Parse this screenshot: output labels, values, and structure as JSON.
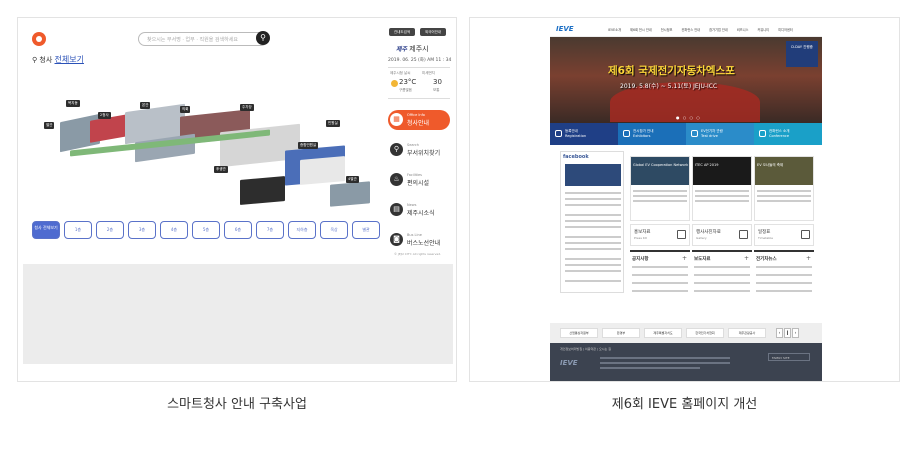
{
  "captions": {
    "left": "스마트청사 안내 구축사업",
    "right": "제6회 IEVE 홈페이지 개선"
  },
  "kiosk": {
    "search_placeholder": "찾으시는 부서명 · 업무 · 직원을 검색하세요",
    "location_label": "청사",
    "location_link": "전체보기",
    "top_buttons": [
      "관내도검색",
      "외국어안내"
    ],
    "brand_logo": "제주",
    "brand_name": "제주시",
    "date": "2019. 06. 25 (화)",
    "time": "AM 11 : 34",
    "weather": {
      "left_label": "제주시청 날씨",
      "temp": "23°C",
      "temp_sub": "구름많음",
      "right_label": "미세먼지",
      "dust": "30",
      "dust_sub": "보통"
    },
    "menu": [
      {
        "en": "Office Info",
        "ko": "청사안내",
        "icon": "building-icon"
      },
      {
        "en": "Search",
        "ko": "부서위치찾기",
        "icon": "search-icon"
      },
      {
        "en": "Facilities",
        "ko": "편의시설",
        "icon": "facility-icon"
      },
      {
        "en": "News",
        "ko": "제주시소식",
        "icon": "news-icon"
      },
      {
        "en": "Bus Line",
        "ko": "버스노선안내",
        "icon": "bus-icon"
      }
    ],
    "copyright": "© JEJU CITY. All rights reserved.",
    "map_labels": [
      "복지동",
      "별관",
      "2청사",
      "본관",
      "의회",
      "주차장",
      "민원실",
      "종합민원실",
      "후생관",
      "4별관"
    ],
    "floors": [
      "청사 전체보기",
      "1층",
      "2층",
      "3층",
      "4층",
      "5층",
      "6층",
      "7층",
      "지하층",
      "옥상",
      "별관",
      "후생관"
    ]
  },
  "site": {
    "logo": "IEVE",
    "nav": [
      "IEVE소개",
      "제6회 전시 안내",
      "전시정보",
      "컨퍼런스 안내",
      "참가기업 안내",
      "비즈니스",
      "커뮤니티",
      "미디어센터"
    ],
    "hero_title": "제6회 국제전기자동차엑스포",
    "hero_date": "2019. 5.8(수) ~ 5.11(토) JEJU-ICC",
    "hero_side": "D-DAY 진행중",
    "quick_links": [
      {
        "label": "등록안내",
        "sub": "Registration"
      },
      {
        "label": "전시참가 안내",
        "sub": "Exhibitors"
      },
      {
        "label": "EV전기차 관람",
        "sub": "Test drive"
      },
      {
        "label": "컨퍼런스 소개",
        "sub": "Conference"
      }
    ],
    "facebook": "facebook",
    "tiles": [
      {
        "title": "Global EV Cooperation Network",
        "color": "#2e4a63"
      },
      {
        "title": "ITEC AP 2019",
        "color": "#1a1a1a"
      },
      {
        "title": "EV 오너들의 축제",
        "color": "#5b5a3a"
      }
    ],
    "services": [
      {
        "ko": "홍보자료",
        "en": "Press Kit"
      },
      {
        "ko": "행사사진자료",
        "en": "Gallery"
      },
      {
        "ko": "일정표",
        "en": "Timetable"
      }
    ],
    "boards": [
      "공지사항",
      "보도자료",
      "전기차뉴스"
    ],
    "partners": [
      "산업통상자원부",
      "환경부",
      "제주특별자치도",
      "한국전기차협회",
      "제주관광공사"
    ],
    "footer_links": "개인정보처리방침 | 이용약관 | 오시는 길",
    "footer_logo": "IEVE",
    "family_site": "FAMILY SITE"
  }
}
